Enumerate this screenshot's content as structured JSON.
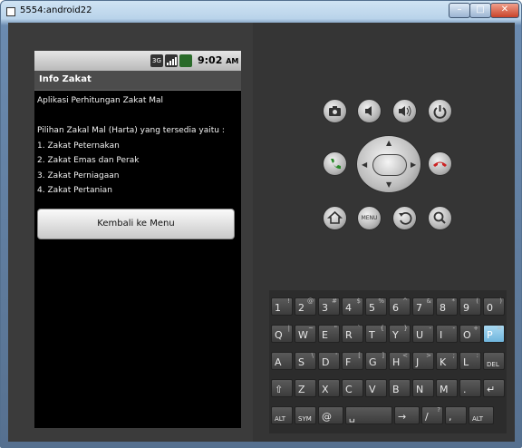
{
  "window": {
    "title": "5554:android22",
    "min": "–",
    "max": "□",
    "close": "✕"
  },
  "statusbar": {
    "time": "9:02",
    "ampm": "AM",
    "icons": [
      "3G-icon",
      "signal-icon",
      "battery-icon"
    ],
    "three_g": "3G"
  },
  "app": {
    "title": "Info Zakat",
    "lines": [
      "Aplikasi Perhitungan Zakat Mal",
      "",
      "Pilihan Zakal Mal (Harta) yang tersedia yaitu :",
      "1. Zakat Peternakan",
      "2. Zakat Emas dan Perak",
      "3. Zakat Perniagaan",
      "4. Zakat Pertanian"
    ],
    "button": "Kembali ke Menu"
  },
  "controls": {
    "camera": "📷",
    "vol_down": "◀)",
    "vol_up": "◀))",
    "power": "⏻",
    "call": "✆",
    "end": "☎",
    "home": "⌂",
    "menu": "MENU",
    "back": "↶",
    "search": "⌕"
  },
  "keyboard": {
    "rows": [
      [
        [
          "1",
          "!"
        ],
        [
          "2",
          "@"
        ],
        [
          "3",
          "#"
        ],
        [
          "4",
          "$"
        ],
        [
          "5",
          "%"
        ],
        [
          "6",
          "^"
        ],
        [
          "7",
          "&"
        ],
        [
          "8",
          "*"
        ],
        [
          "9",
          "("
        ],
        [
          "0",
          ")"
        ]
      ],
      [
        [
          "Q",
          "|"
        ],
        [
          "W",
          "~"
        ],
        [
          "E",
          "\""
        ],
        [
          "R",
          "`"
        ],
        [
          "T",
          "{"
        ],
        [
          "Y",
          "}"
        ],
        [
          "U",
          "-"
        ],
        [
          "I",
          "-"
        ],
        [
          "O",
          "+"
        ],
        [
          "P",
          "="
        ]
      ],
      [
        [
          "A",
          ""
        ],
        [
          "S",
          "\\"
        ],
        [
          "D",
          "'"
        ],
        [
          "F",
          "["
        ],
        [
          "G",
          "]"
        ],
        [
          "H",
          "<"
        ],
        [
          "J",
          ">"
        ],
        [
          "K",
          ";"
        ],
        [
          "L",
          ":"
        ],
        [
          "DEL",
          ""
        ]
      ],
      [
        [
          "⇧",
          ""
        ],
        [
          "Z",
          ""
        ],
        [
          "X",
          ""
        ],
        [
          "C",
          ""
        ],
        [
          "V",
          ""
        ],
        [
          "B",
          ""
        ],
        [
          "N",
          ""
        ],
        [
          "M",
          ""
        ],
        [
          ".",
          ""
        ],
        [
          "↵",
          ""
        ]
      ],
      [
        [
          "ALT",
          ""
        ],
        [
          "SYM",
          ""
        ],
        [
          "@",
          ""
        ],
        [
          "␣",
          ""
        ],
        [
          "→",
          ""
        ],
        [
          "/",
          "?"
        ],
        [
          ",",
          ""
        ],
        [
          "ALT",
          ""
        ]
      ]
    ]
  }
}
